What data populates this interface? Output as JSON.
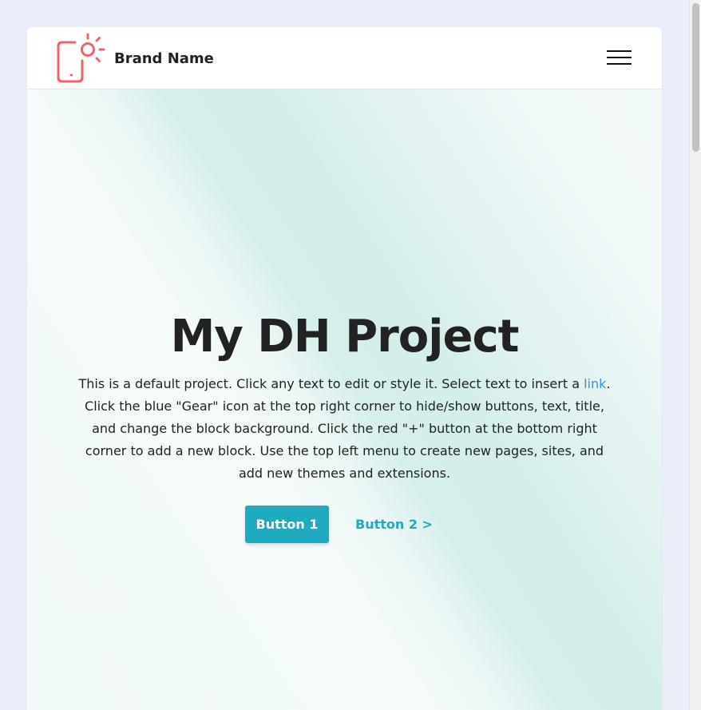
{
  "navbar": {
    "brand_name": "Brand Name",
    "logo_icon": "phone-sun-icon",
    "menu_icon": "hamburger-menu-icon"
  },
  "hero": {
    "title": "My DH Project",
    "text_before_link": "This is a default project. Click any text to edit or style it. Select text to insert a ",
    "link_text": "link",
    "text_after_link": ". Click the blue \"Gear\" icon at the top right corner to hide/show buttons, text, title, and change the block background. Click the red \"+\" button at the bottom right corner to add a new block. Use the top left menu to create new pages, sites, and add new themes and extensions.",
    "button1_label": "Button 1",
    "button2_label": "Button 2 >"
  },
  "colors": {
    "accent": "#1eabc0",
    "logo": "#f0636b",
    "link": "#3d8fd8",
    "page_background": "#e9eef9"
  }
}
